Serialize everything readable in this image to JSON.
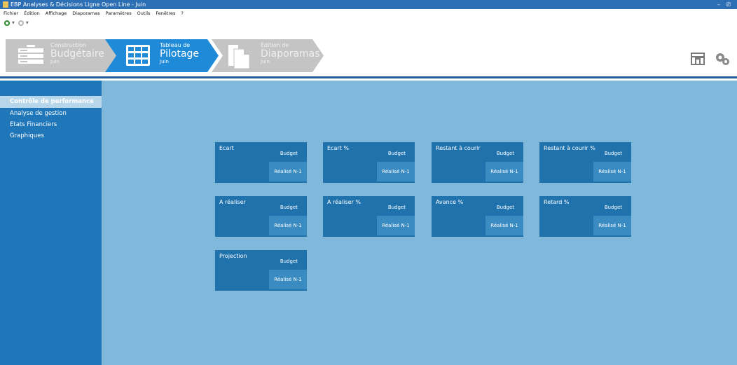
{
  "window": {
    "title": "EBP Analyses & Décisions Ligne Open Line - Juin",
    "controls": "– ⎚"
  },
  "menu": [
    "Fichier",
    "Édition",
    "Affichage",
    "Diaporamas",
    "Paramètres",
    "Outils",
    "Fenêtres",
    "?"
  ],
  "workflow": [
    {
      "small": "Construction",
      "big": "Budgétaire",
      "sub": "Juin",
      "state": "inactive",
      "icon": "database-icon"
    },
    {
      "small": "Tableau de",
      "big": "Pilotage",
      "sub": "Juin",
      "state": "active",
      "icon": "grid-table-icon"
    },
    {
      "small": "Édition de",
      "big": "Diaporamas",
      "sub": "Juin",
      "state": "inactive",
      "icon": "document-icon"
    }
  ],
  "toolbar_right": [
    "dashboard-icon",
    "settings-gears-icon"
  ],
  "sidebar": {
    "items": [
      {
        "label": "Contrôle de performance",
        "active": true
      },
      {
        "label": "Analyse de gestion",
        "active": false
      },
      {
        "label": "Etats Financiers",
        "active": false
      },
      {
        "label": "Graphiques",
        "active": false
      }
    ]
  },
  "tiles": [
    {
      "title": "Ecart",
      "budget": "Budget",
      "realise": "Réalisé N-1"
    },
    {
      "title": "Ecart %",
      "budget": "Budget",
      "realise": "Réalisé N-1"
    },
    {
      "title": "Restant à courir",
      "budget": "Budget",
      "realise": "Réalisé N-1"
    },
    {
      "title": "Restant à courir %",
      "budget": "Budget",
      "realise": "Réalisé N-1"
    },
    {
      "title": "A réaliser",
      "budget": "Budget",
      "realise": "Réalisé N-1"
    },
    {
      "title": "A réaliser %",
      "budget": "Budget",
      "realise": "Réalisé N-1"
    },
    {
      "title": "Avance %",
      "budget": "Budget",
      "realise": "Réalisé N-1"
    },
    {
      "title": "Retard %",
      "budget": "Budget",
      "realise": "Réalisé N-1"
    },
    {
      "title": "Projection",
      "budget": "Budget",
      "realise": "Réalisé N-1"
    }
  ],
  "colors": {
    "accent": "#2d6fb4",
    "sidebar": "#1f76b9",
    "main": "#7fb8da",
    "tile": "#2072ad",
    "step_active": "#1e8ad8",
    "step_inactive": "#c4c4c4"
  }
}
